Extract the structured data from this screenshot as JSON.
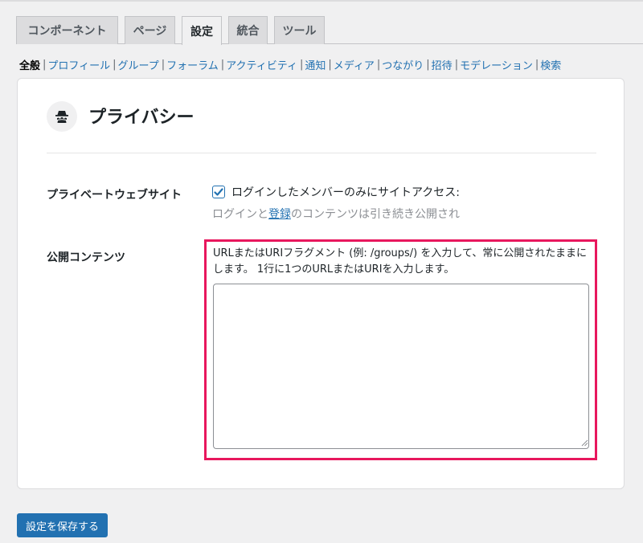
{
  "tabs": [
    {
      "label": "コンポーネント",
      "active": false
    },
    {
      "label": "ページ",
      "active": false
    },
    {
      "label": "設定",
      "active": true
    },
    {
      "label": "統合",
      "active": false
    },
    {
      "label": "ツール",
      "active": false
    }
  ],
  "subnav": {
    "current": "全般",
    "items": [
      "プロフィール",
      "グループ",
      "フォーラム",
      "アクティビティ",
      "通知",
      "メディア",
      "つながり",
      "招待",
      "モデレーション",
      "検索"
    ]
  },
  "card": {
    "icon": "incognito-icon",
    "title": "プライバシー"
  },
  "private_site": {
    "label": "プライベートウェブサイト",
    "checked": true,
    "checkbox_label": "ログインしたメンバーのみにサイトアクセス:",
    "desc_prefix": "ログインと",
    "desc_link": "登録",
    "desc_suffix": "のコンテンツは引き続き公開され"
  },
  "public_content": {
    "label": "公開コンテンツ",
    "description": "URLまたはURIフラグメント (例: /groups/) を入力して、常に公開されたままにします。 1行に1つのURLまたはURIを入力します。",
    "value": ""
  },
  "save_button": "設定を保存する",
  "colors": {
    "accent": "#2271b1",
    "highlight": "#e8175d"
  }
}
